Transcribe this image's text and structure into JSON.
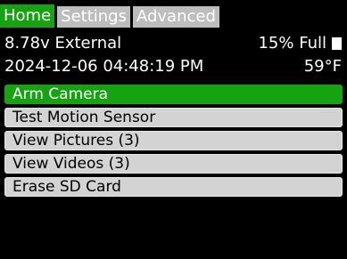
{
  "tabs": [
    {
      "label": "Home",
      "active": true
    },
    {
      "label": "Settings",
      "active": false
    },
    {
      "label": "Advanced",
      "active": false
    }
  ],
  "status": {
    "power": "8.78v External",
    "storage": "15% Full",
    "storage_icon": "sd-card-icon",
    "datetime": "2024-12-06 04:48:19 PM",
    "temperature": "59°F"
  },
  "menu": [
    {
      "label": "Arm Camera",
      "selected": true
    },
    {
      "label": "Test Motion Sensor",
      "selected": false
    },
    {
      "label": "View Pictures (3)",
      "selected": false
    },
    {
      "label": "View Videos (3)",
      "selected": false
    },
    {
      "label": "Erase SD Card",
      "selected": false
    }
  ],
  "colors": {
    "accent": "#16a312",
    "tab_inactive": "#bdbdbd",
    "menu_item": "#d3d3d3",
    "background": "#000000"
  }
}
